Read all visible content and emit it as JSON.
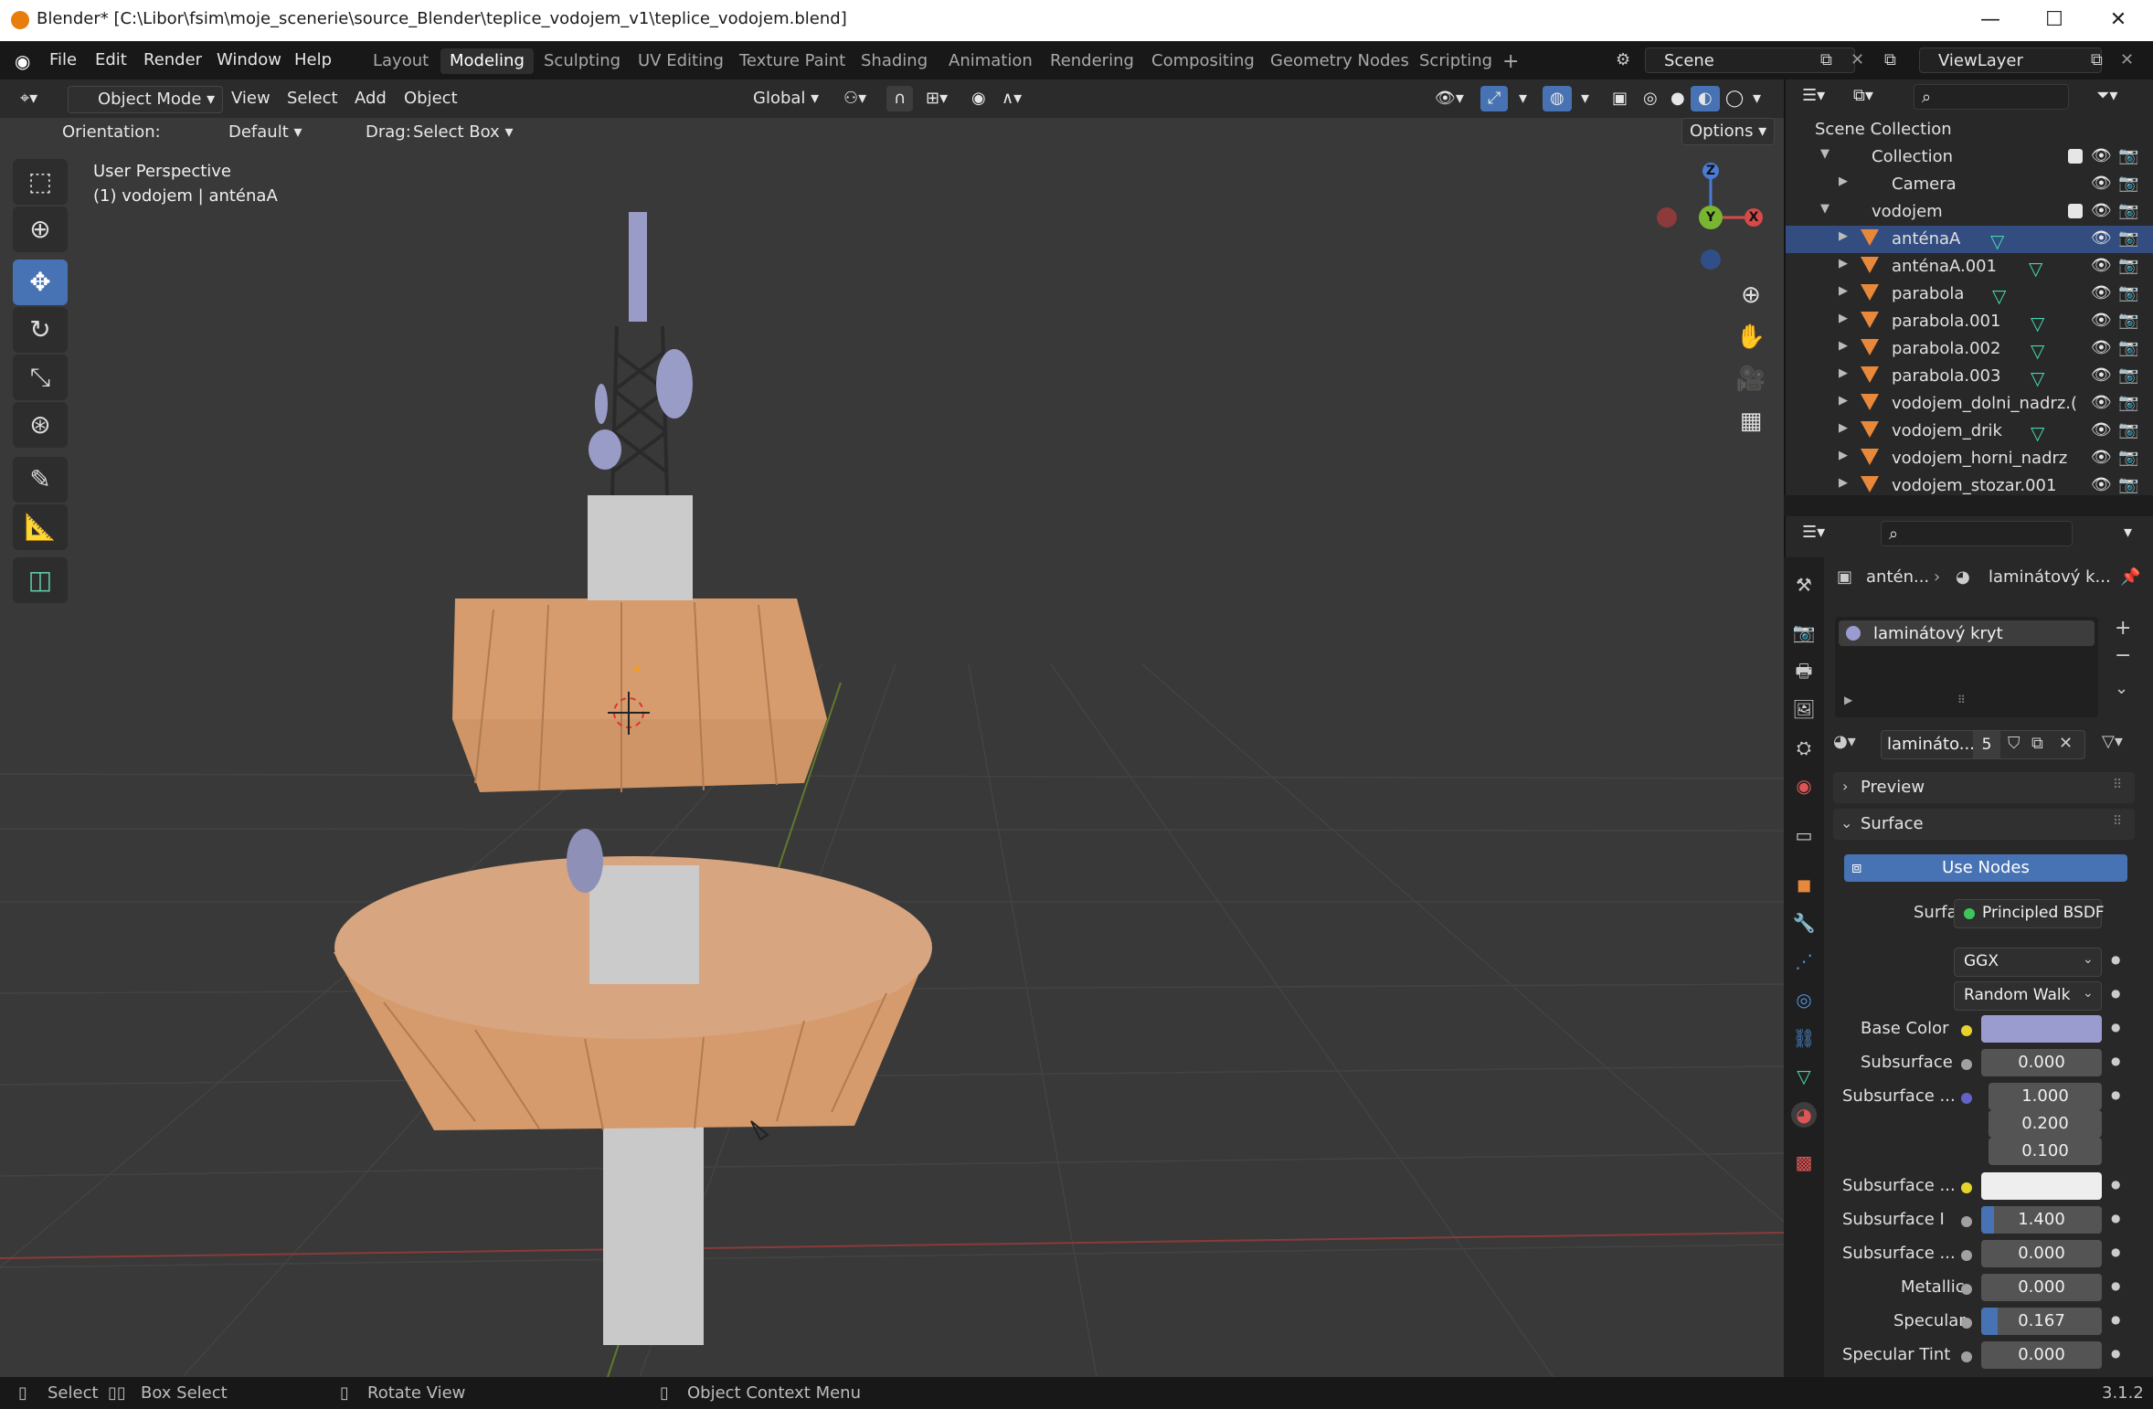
{
  "window": {
    "title": "Blender* [C:\\Libor\\fsim\\moje_scenerie\\source_Blender\\teplice_vodojem_v1\\teplice_vodojem.blend]",
    "min": "—",
    "max": "☐",
    "close": "✕"
  },
  "menu": [
    "File",
    "Edit",
    "Render",
    "Window",
    "Help"
  ],
  "workspaces": [
    "Layout",
    "Modeling",
    "Sculpting",
    "UV Editing",
    "Texture Paint",
    "Shading",
    "Animation",
    "Rendering",
    "Compositing",
    "Geometry Nodes",
    "Scripting"
  ],
  "active_workspace": "Modeling",
  "scene_field": "Scene",
  "viewlayer_field": "ViewLayer",
  "viewport_header": {
    "mode": "Object Mode",
    "menus": [
      "View",
      "Select",
      "Add",
      "Object"
    ],
    "transform": "Global",
    "orientation_label": "Orientation:",
    "orientation_value": "Default",
    "drag_label": "Drag:",
    "drag_value": "Select Box",
    "options": "Options"
  },
  "viewport": {
    "perspective": "User Perspective",
    "context": "(1) vodojem | anténaA",
    "gizmo_z": "Z",
    "gizmo_x": "X",
    "gizmo_y": "Y"
  },
  "outliner": {
    "root": "Scene Collection",
    "collection": "Collection",
    "camera": "Camera",
    "group": "vodojem",
    "objects": [
      "anténaA",
      "anténaA.001",
      "parabola",
      "parabola.001",
      "parabola.002",
      "parabola.003",
      "vodojem_dolni_nadrz.(",
      "vodojem_drik",
      "vodojem_horni_nadrz",
      "vodojem_stozar.001"
    ]
  },
  "properties": {
    "breadcrumb_obj": "antén...",
    "breadcrumb_mat": "laminátový k...",
    "slot": "laminátový kryt",
    "material_name": "lamináto...",
    "user_count": "5",
    "panel_preview": "Preview",
    "panel_surface": "Surface",
    "use_nodes": "Use Nodes",
    "surface_label": "Surface",
    "surface_value": "Principled BSDF",
    "distribution": "GGX",
    "subsurface_method": "Random Walk",
    "fields": [
      {
        "label": "Base Color",
        "value": ""
      },
      {
        "label": "Subsurface",
        "value": "0.000"
      },
      {
        "label": "Subsurface ...",
        "value": "1.000"
      },
      {
        "label": "",
        "value": "0.200"
      },
      {
        "label": "",
        "value": "0.100"
      },
      {
        "label": "Subsurface ...",
        "value": ""
      },
      {
        "label": "Subsurface I",
        "value": "1.400"
      },
      {
        "label": "Subsurface ...",
        "value": "0.000"
      },
      {
        "label": "Metallic",
        "value": "0.000"
      },
      {
        "label": "Specular",
        "value": "0.167"
      },
      {
        "label": "Specular Tint",
        "value": "0.000"
      }
    ],
    "base_color": "#9a9ccf"
  },
  "statusbar": {
    "select": "Select",
    "box_select": "Box Select",
    "rotate": "Rotate View",
    "context_menu": "Object Context Menu",
    "version": "3.1.2"
  }
}
